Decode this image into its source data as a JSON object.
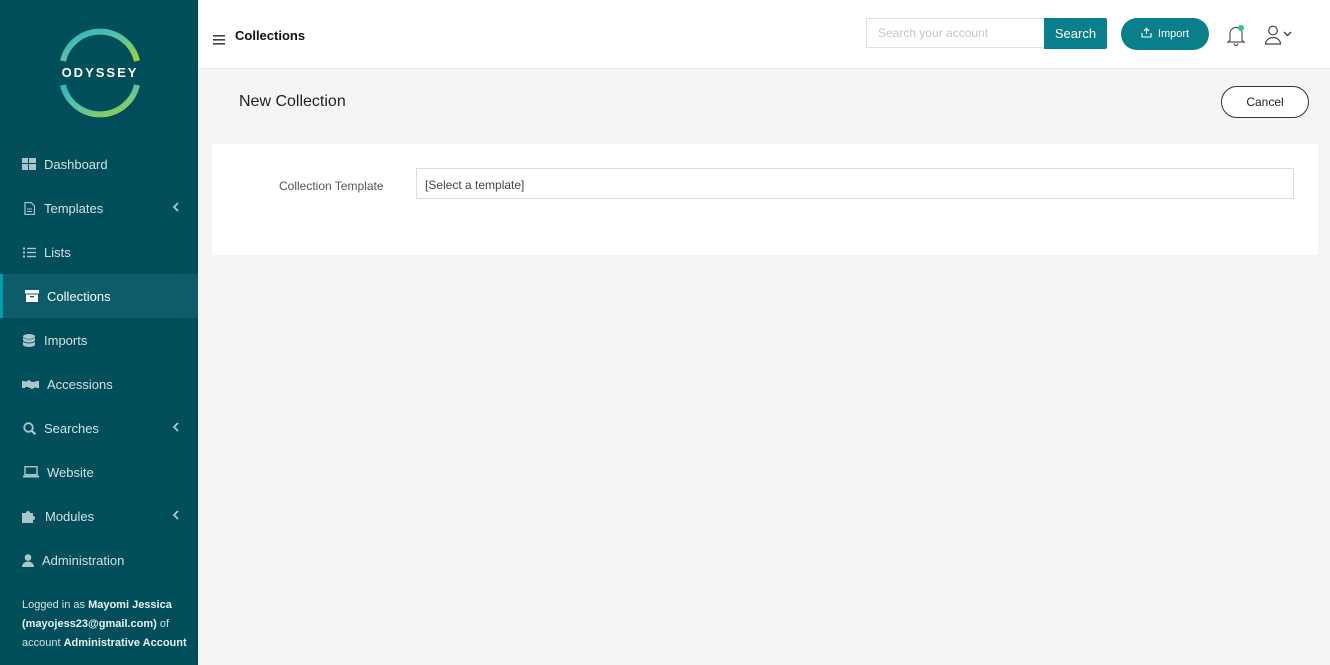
{
  "brand": {
    "logo_text": "ODYSSEY",
    "accent": "#0a7f8c",
    "sidebar_bg": "#004e5a"
  },
  "sidebar": {
    "items": [
      {
        "label": "Dashboard",
        "icon": "dashboard-icon"
      },
      {
        "label": "Templates",
        "icon": "document-icon",
        "has_submenu": true
      },
      {
        "label": "Lists",
        "icon": "list-icon"
      },
      {
        "label": "Collections",
        "icon": "archive-box-icon",
        "active": true
      },
      {
        "label": "Imports",
        "icon": "database-icon"
      },
      {
        "label": "Accessions",
        "icon": "handshake-icon"
      },
      {
        "label": "Searches",
        "icon": "search-icon",
        "has_submenu": true
      },
      {
        "label": "Website",
        "icon": "laptop-icon"
      },
      {
        "label": "Modules",
        "icon": "puzzle-icon",
        "has_submenu": true
      },
      {
        "label": "Administration",
        "icon": "user-icon"
      }
    ],
    "login": {
      "prefix": "Logged in as",
      "name": "Mayomi Jessica",
      "email": "(mayojess23@gmail.com)",
      "of_account": "of account",
      "account": "Administrative Account"
    }
  },
  "header": {
    "crumb": "Collections",
    "search_placeholder": "Search your account",
    "search_label": "Search",
    "import_label": "Import"
  },
  "main": {
    "title": "New Collection",
    "cancel_label": "Cancel",
    "form": {
      "template_label": "Collection Template",
      "template_value": "[Select a template]"
    }
  }
}
